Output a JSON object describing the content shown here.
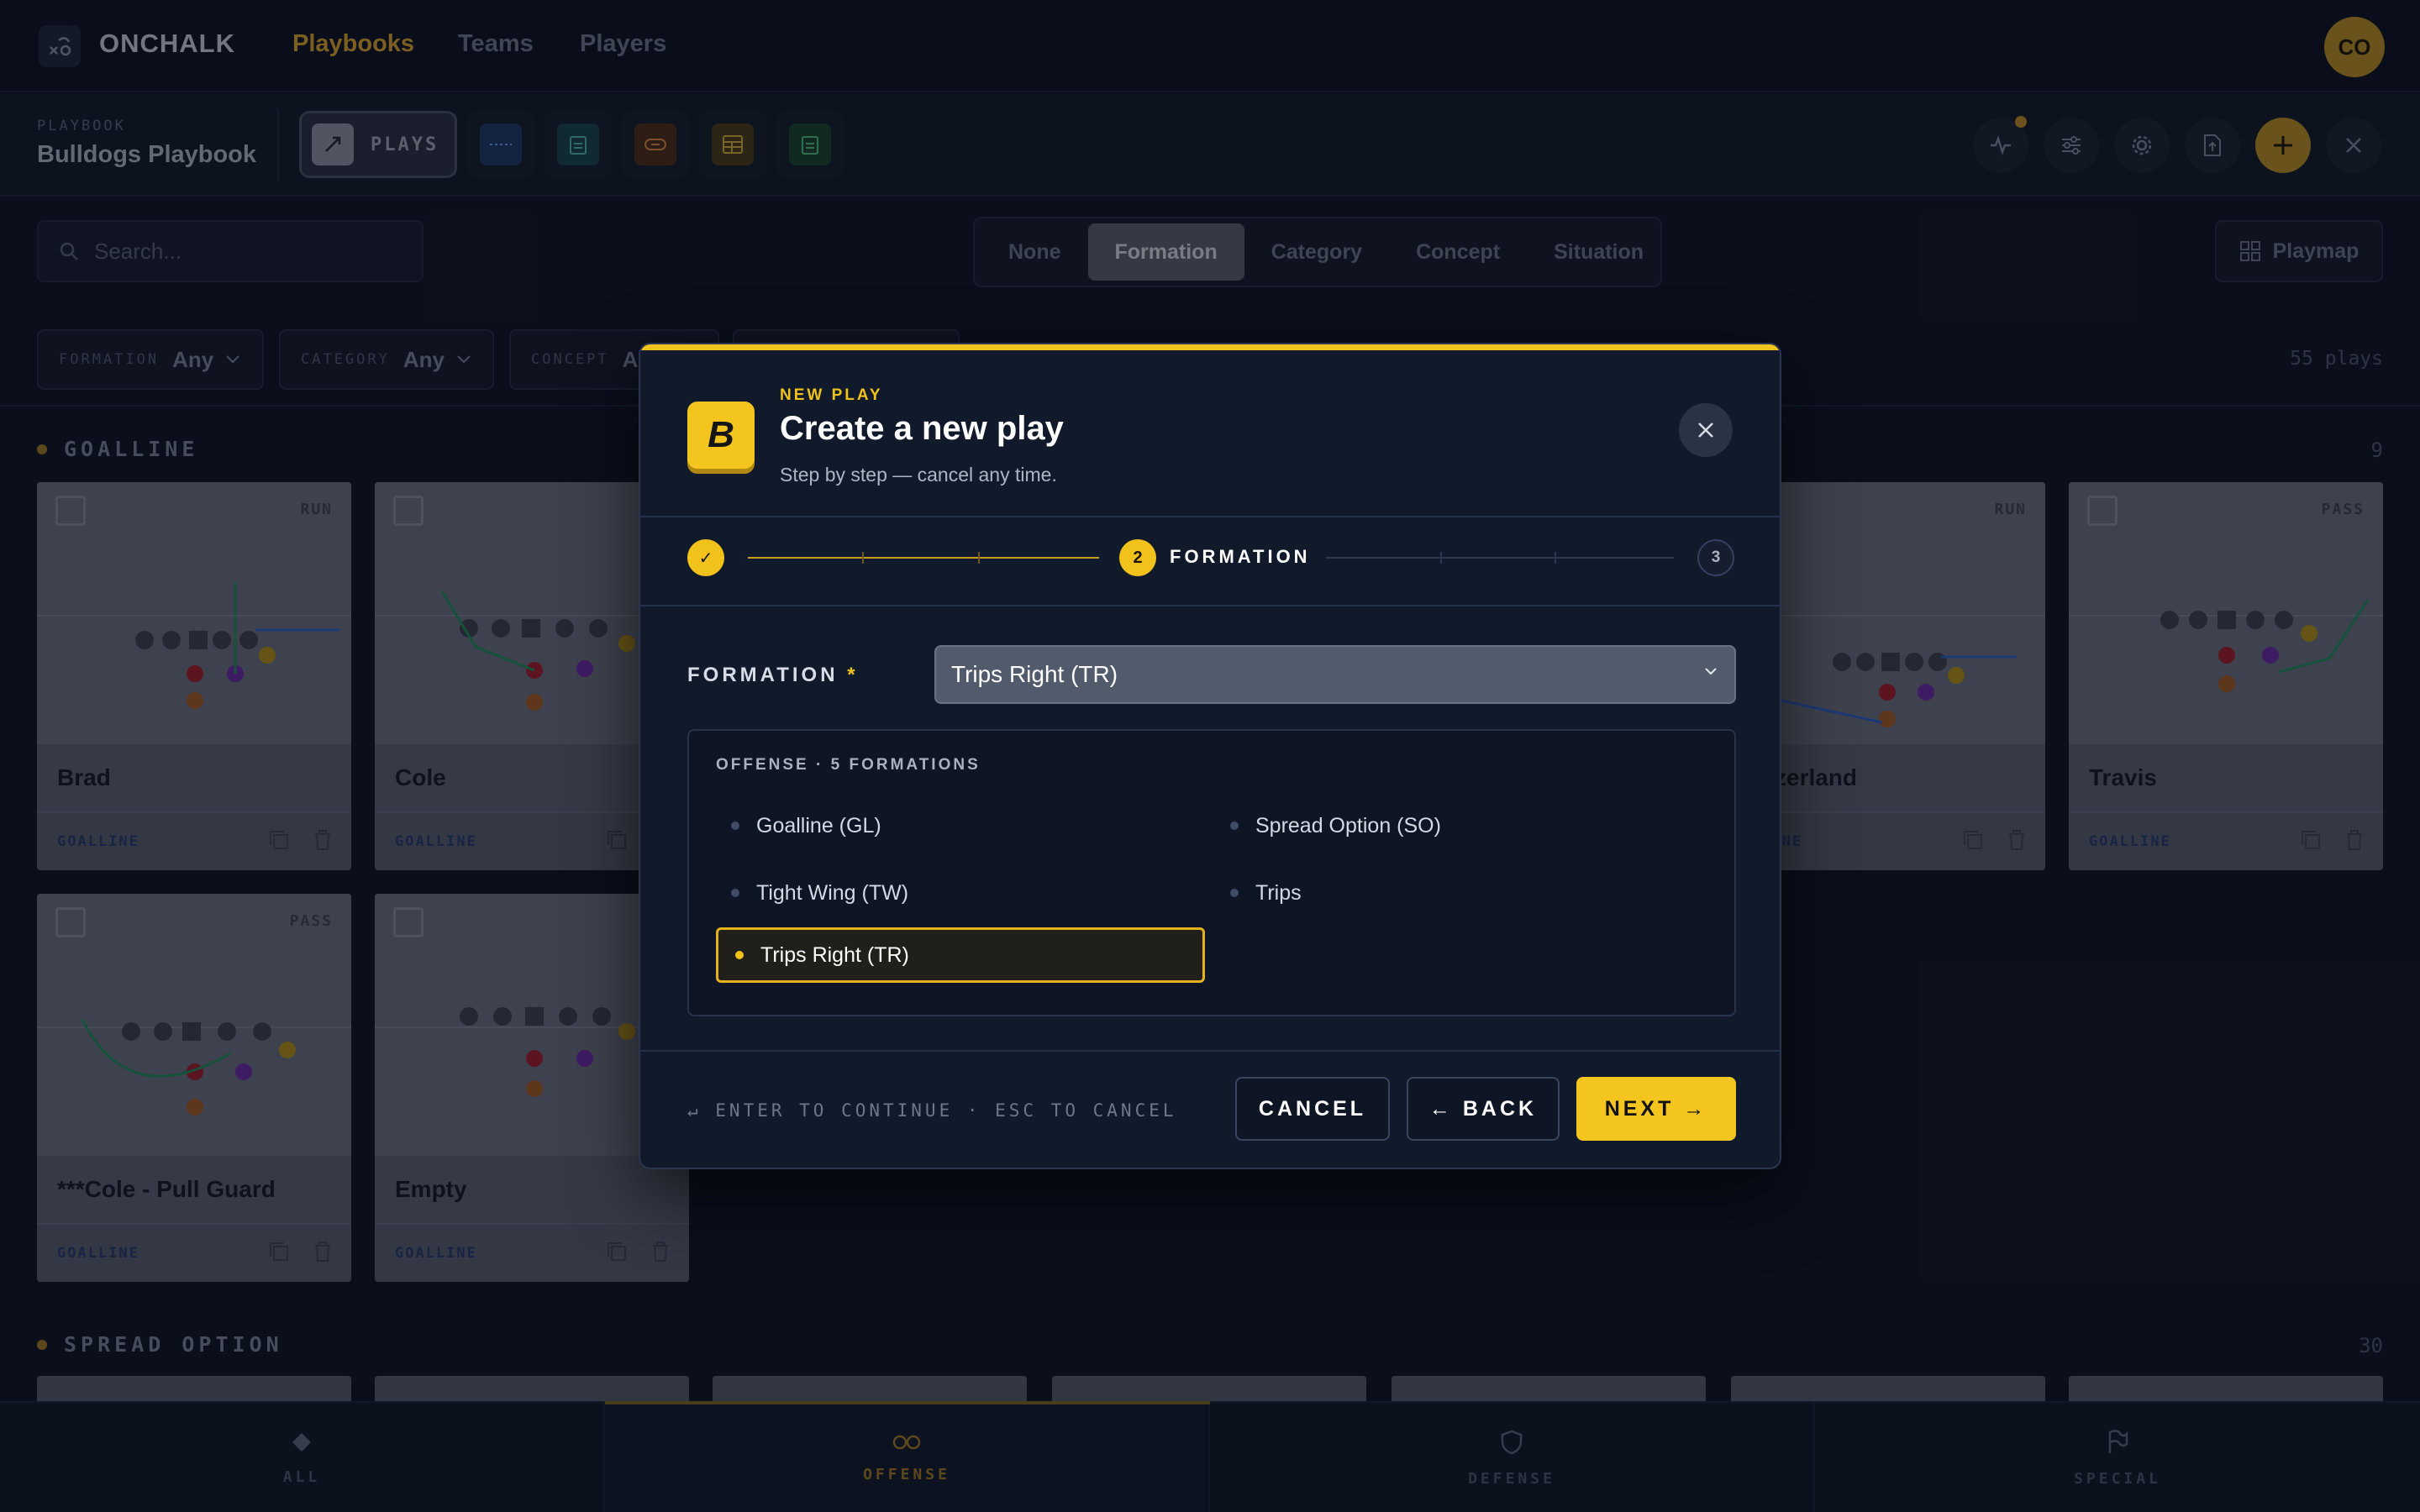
{
  "nav": {
    "brand": "ONCHALK",
    "links": [
      "Playbooks",
      "Teams",
      "Players"
    ],
    "avatar_initials": "CO"
  },
  "toolbar": {
    "playbook_label": "PLAYBOOK",
    "playbook_name": "Bulldogs Playbook",
    "plays_label": "PLAYS"
  },
  "search": {
    "placeholder": "Search..."
  },
  "grouping": {
    "options": [
      "None",
      "Formation",
      "Category",
      "Concept",
      "Situation"
    ],
    "selected": "Formation"
  },
  "playmap_label": "Playmap",
  "filters": [
    {
      "key": "FORMATION",
      "value": "Any"
    },
    {
      "key": "CATEGORY",
      "value": "Any"
    },
    {
      "key": "CONCEPT",
      "value": "An"
    }
  ],
  "plays_count": "55 plays",
  "sections": [
    {
      "title": "GOALLINE",
      "count": "9"
    },
    {
      "title": "SPREAD OPTION",
      "count": "30"
    }
  ],
  "cards": [
    {
      "name": "Brad",
      "tag": "RUN",
      "category": "GOALLINE"
    },
    {
      "name": "Cole",
      "tag": "",
      "category": "GOALLINE"
    },
    {
      "name": "ritzerland",
      "tag": "RUN",
      "category": "LLINE"
    },
    {
      "name": "Travis",
      "tag": "PASS",
      "category": "GOALLINE"
    },
    {
      "name": "***Cole - Pull Guard",
      "tag": "PASS",
      "category": "GOALLINE"
    },
    {
      "name": "Empty",
      "tag": "",
      "category": "GOALLINE"
    }
  ],
  "bottom_nav": [
    {
      "label": "ALL",
      "icon": "diamond-icon"
    },
    {
      "label": "OFFENSE",
      "icon": "offense-circles-icon",
      "active": true
    },
    {
      "label": "DEFENSE",
      "icon": "shield-icon"
    },
    {
      "label": "SPECIAL",
      "icon": "flag-icon"
    }
  ],
  "modal": {
    "eyebrow": "NEW PLAY",
    "title": "Create a new play",
    "subtitle": "Step by step — cancel any time.",
    "logo_letter": "B",
    "steps": {
      "done_mark": "✓",
      "current_number": "2",
      "current_label": "FORMATION",
      "next_number": "3"
    },
    "field_label": "FORMATION",
    "required_mark": "*",
    "selected_value": "Trips Right (TR)",
    "list_header": "OFFENSE · 5 FORMATIONS",
    "options": [
      "Goalline (GL)",
      "Spread Option (SO)",
      "Tight Wing (TW)",
      "Trips",
      "Trips Right (TR)"
    ],
    "hint": "↵ ENTER TO CONTINUE · ESC TO CANCEL",
    "cancel_label": "CANCEL",
    "back_label": "← BACK",
    "next_label": "NEXT →"
  },
  "colors": {
    "accent": "#f1c21b",
    "background": "#0d1321",
    "modal_bg": "#111a2b"
  }
}
